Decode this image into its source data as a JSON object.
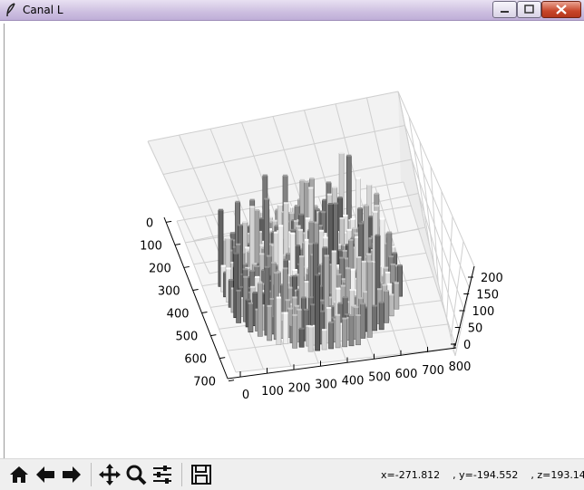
{
  "window": {
    "title": "Canal L"
  },
  "toolbar": {
    "buttons": [
      "home-icon",
      "back-arrow-icon",
      "forward-arrow-icon",
      "pan-icon",
      "zoom-icon",
      "subplots-icon",
      "save-icon"
    ],
    "coords": "x=-271.812    , y=-194.552    , z=193.143"
  },
  "chart_data": {
    "type": "3d-bar",
    "colormap": "grayscale",
    "x_ticks": [
      "0",
      "100",
      "200",
      "300",
      "400",
      "500",
      "600",
      "700",
      "800"
    ],
    "y_ticks": [
      "0",
      "100",
      "200",
      "300",
      "400",
      "500",
      "600",
      "700"
    ],
    "z_ticks": [
      "0",
      "50",
      "100",
      "150",
      "200"
    ],
    "x_range": [
      0,
      800
    ],
    "y_range": [
      0,
      700
    ],
    "z_range": [
      0,
      200
    ],
    "grid": true
  }
}
